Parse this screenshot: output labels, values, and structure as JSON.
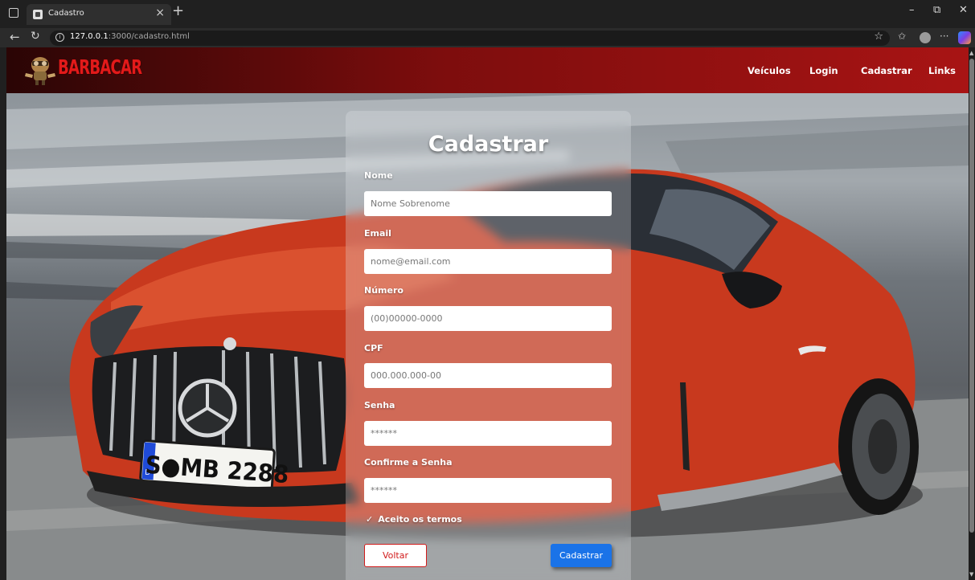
{
  "browser": {
    "tab_title": "Cadastro",
    "url_host": "127.0.0.1",
    "url_path": ":3000/cadastro.html"
  },
  "navbar": {
    "logo_text": "BARBACAR",
    "links": [
      "Veículos",
      "Login",
      "Cadastrar",
      "Links"
    ]
  },
  "form": {
    "title": "Cadastrar",
    "fields": [
      {
        "label": "Nome",
        "placeholder": "Nome Sobrenome",
        "type": "text"
      },
      {
        "label": "Email",
        "placeholder": "nome@email.com",
        "type": "email"
      },
      {
        "label": "Número",
        "placeholder": "(00)00000-0000",
        "type": "text"
      },
      {
        "label": "CPF",
        "placeholder": "000.000.000-00",
        "type": "text"
      },
      {
        "label": "Senha",
        "placeholder": "******",
        "type": "password"
      },
      {
        "label": "Confirme a Senha",
        "placeholder": "******",
        "type": "password"
      }
    ],
    "terms_label": "Aceito os termos",
    "back_label": "Voltar",
    "submit_label": "Cadastrar"
  },
  "hero": {
    "plate_text": "S●MB 2288",
    "plate_country": "D"
  },
  "colors": {
    "navbar_dark": "#2a0505",
    "navbar_red": "#a81414",
    "primary_button": "#1a73e8",
    "back_button": "#d11a1a",
    "car_red": "#c8391e"
  }
}
